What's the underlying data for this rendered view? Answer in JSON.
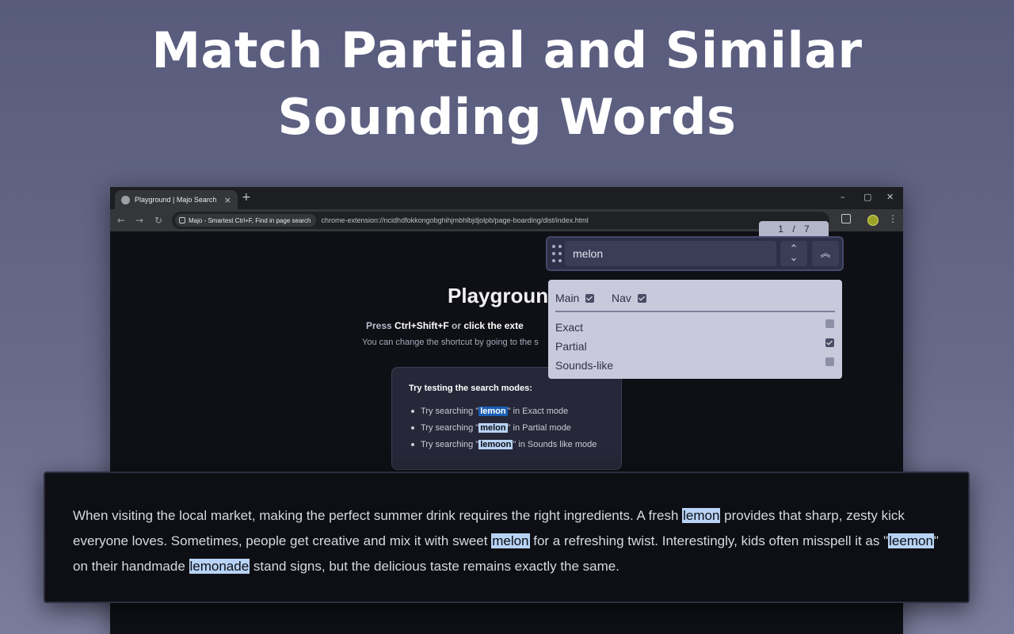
{
  "hero": {
    "line1": "Match Partial and Similar",
    "line2": "Sounding Words"
  },
  "browser": {
    "tab_title": "Playground | Majo Search",
    "tab_close": "×",
    "new_tab": "+",
    "window_controls": [
      "–",
      "▢",
      "✕"
    ],
    "nav": {
      "back": "←",
      "forward": "→",
      "reload": "↻"
    },
    "chip_text": "Majo - Smartest Ctrl+F, Find in page search",
    "url": "chrome-extension://ncidhdfokkongobghihjmbhlbjdjolpb/page-boarding/dist/index.html",
    "kebab": "⋮"
  },
  "page": {
    "heading": "Playgroun",
    "instr_press": "Press ",
    "instr_shortcut": "Ctrl+Shift+F",
    "instr_or": " or ",
    "instr_click": "click the exte",
    "instr2": "You can change the shortcut by going to the s",
    "modes_title": "Try testing the search modes:",
    "modes": [
      {
        "pre": "Try searching \"",
        "word": "lemon",
        "post": "\" in Exact mode"
      },
      {
        "pre": "Try searching \"",
        "word": "melon",
        "post": "\" in Partial mode"
      },
      {
        "pre": "Try searching \"",
        "word": "lemoon",
        "post": "\" in Sounds like mode"
      }
    ]
  },
  "search": {
    "counter_current": "1",
    "counter_sep": "/",
    "counter_total": "7",
    "query": "melon",
    "up_down_up": "⌃",
    "up_down_down": "⌄",
    "collapse": "︽",
    "scopes": [
      {
        "label": "Main",
        "checked": true
      },
      {
        "label": "Nav",
        "checked": true
      }
    ],
    "modes": [
      {
        "label": "Exact",
        "checked": false
      },
      {
        "label": "Partial",
        "checked": true
      },
      {
        "label": "Sounds-like",
        "checked": false
      }
    ]
  },
  "overlay": {
    "t1": "When visiting the local market, making the perfect summer drink requires the right ingredients. A fresh ",
    "h1": "lemon",
    "t2": " provides that sharp, zesty kick everyone loves. Sometimes, people get creative and mix it with sweet ",
    "h2": "melon",
    "t3": " for a refreshing twist. Interestingly, kids often misspell it as \"",
    "h3": "leemon",
    "t4": "\" on their handmade ",
    "h4": "lemonade",
    "t5": " stand signs, but the delicious taste remains exactly the same."
  }
}
